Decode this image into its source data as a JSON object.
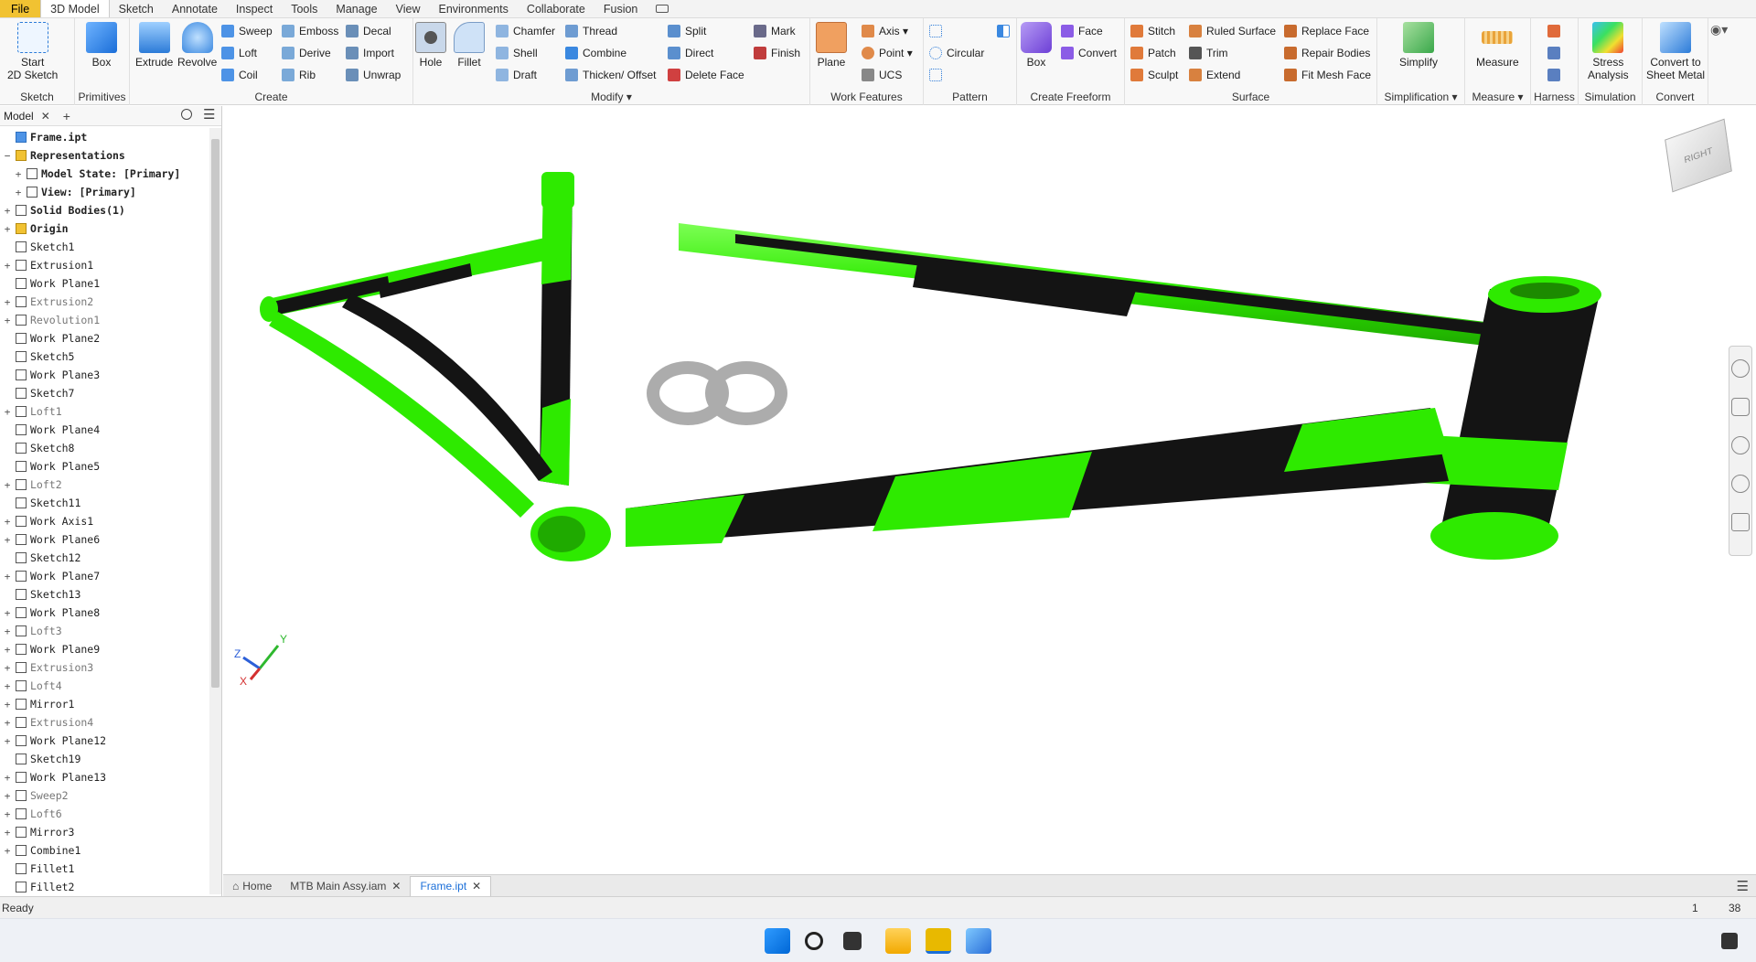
{
  "menu": {
    "items": [
      "File",
      "3D Model",
      "Sketch",
      "Annotate",
      "Inspect",
      "Tools",
      "Manage",
      "View",
      "Environments",
      "Collaborate",
      "Fusion"
    ],
    "active": "3D Model"
  },
  "ribbon": {
    "sketch": {
      "label": "Sketch",
      "start": "Start\n2D Sketch"
    },
    "primitives": {
      "label": "Primitives",
      "box": "Box"
    },
    "create": {
      "label": "Create",
      "extrude": "Extrude",
      "revolve": "Revolve",
      "sweep": "Sweep",
      "emboss": "Emboss",
      "decal": "Decal",
      "loft": "Loft",
      "derive": "Derive",
      "import": "Import",
      "coil": "Coil",
      "rib": "Rib",
      "unwrap": "Unwrap"
    },
    "modify": {
      "label": "Modify",
      "hole": "Hole",
      "fillet": "Fillet",
      "chamfer": "Chamfer",
      "thread": "Thread",
      "split": "Split",
      "shell": "Shell",
      "combine": "Combine",
      "direct": "Direct",
      "draft": "Draft",
      "thicken": "Thicken/ Offset",
      "delete_face": "Delete Face",
      "mark": "Mark",
      "finish": "Finish"
    },
    "work_features": {
      "label": "Work Features",
      "plane": "Plane",
      "axis": "Axis",
      "point": "Point",
      "ucs": "UCS"
    },
    "pattern": {
      "label": "Pattern",
      "circular": "Circular"
    },
    "freeform": {
      "label": "Create Freeform",
      "box": "Box",
      "face": "Face",
      "convert": "Convert"
    },
    "surface": {
      "label": "Surface",
      "stitch": "Stitch",
      "ruled": "Ruled Surface",
      "replace": "Replace Face",
      "patch": "Patch",
      "trim": "Trim",
      "repair": "Repair Bodies",
      "sculpt": "Sculpt",
      "extend": "Extend",
      "fit_mesh": "Fit Mesh Face"
    },
    "simplification": {
      "label": "Simplification",
      "simplify": "Simplify"
    },
    "measure": {
      "label": "Measure",
      "measure": "Measure"
    },
    "harness": {
      "label": "Harness"
    },
    "simulation": {
      "label": "Simulation",
      "stress": "Stress\nAnalysis"
    },
    "convert": {
      "label": "Convert",
      "sheet": "Convert to\nSheet Metal"
    }
  },
  "model_panel": {
    "title": "Model",
    "tree": [
      {
        "label": "Frame.ipt",
        "dim": false
      },
      {
        "label": "Representations",
        "dim": false
      },
      {
        "label": "Model State: [Primary]",
        "dim": false
      },
      {
        "label": "View: [Primary]",
        "dim": false
      },
      {
        "label": "Solid Bodies(1)",
        "dim": false
      },
      {
        "label": "Origin",
        "dim": false
      },
      {
        "label": "Sketch1",
        "dim": false
      },
      {
        "label": "Extrusion1",
        "dim": false
      },
      {
        "label": "Work Plane1",
        "dim": false
      },
      {
        "label": "Extrusion2",
        "dim": true
      },
      {
        "label": "Revolution1",
        "dim": true
      },
      {
        "label": "Work Plane2",
        "dim": false
      },
      {
        "label": "Sketch5",
        "dim": false
      },
      {
        "label": "Work Plane3",
        "dim": false
      },
      {
        "label": "Sketch7",
        "dim": false
      },
      {
        "label": "Loft1",
        "dim": true
      },
      {
        "label": "Work Plane4",
        "dim": false
      },
      {
        "label": "Sketch8",
        "dim": false
      },
      {
        "label": "Work Plane5",
        "dim": false
      },
      {
        "label": "Loft2",
        "dim": true
      },
      {
        "label": "Sketch11",
        "dim": false
      },
      {
        "label": "Work Axis1",
        "dim": false
      },
      {
        "label": "Work Plane6",
        "dim": false
      },
      {
        "label": "Sketch12",
        "dim": false
      },
      {
        "label": "Work Plane7",
        "dim": false
      },
      {
        "label": "Sketch13",
        "dim": false
      },
      {
        "label": "Work Plane8",
        "dim": false
      },
      {
        "label": "Loft3",
        "dim": true
      },
      {
        "label": "Work Plane9",
        "dim": false
      },
      {
        "label": "Extrusion3",
        "dim": true
      },
      {
        "label": "Loft4",
        "dim": true
      },
      {
        "label": "Mirror1",
        "dim": false
      },
      {
        "label": "Extrusion4",
        "dim": true
      },
      {
        "label": "Work Plane12",
        "dim": false
      },
      {
        "label": "Sketch19",
        "dim": false
      },
      {
        "label": "Work Plane13",
        "dim": false
      },
      {
        "label": "Sweep2",
        "dim": true
      },
      {
        "label": "Loft6",
        "dim": true
      },
      {
        "label": "Mirror3",
        "dim": false
      },
      {
        "label": "Combine1",
        "dim": false
      },
      {
        "label": "Fillet1",
        "dim": false
      },
      {
        "label": "Fillet2",
        "dim": false
      }
    ]
  },
  "viewcube": {
    "face": "RIGHT"
  },
  "triad": {
    "x": "X",
    "y": "Y",
    "z": "Z"
  },
  "tabs": [
    {
      "label": "Home"
    },
    {
      "label": "MTB Main Assy.iam"
    },
    {
      "label": "Frame.ipt",
      "active": true
    }
  ],
  "status": {
    "text": "Ready",
    "count1": "1",
    "count2": "38"
  },
  "colors": {
    "frame_green": "#2eea00",
    "frame_black": "#141414",
    "accent": "#1a6ed8",
    "file_tab": "#f1c232"
  }
}
